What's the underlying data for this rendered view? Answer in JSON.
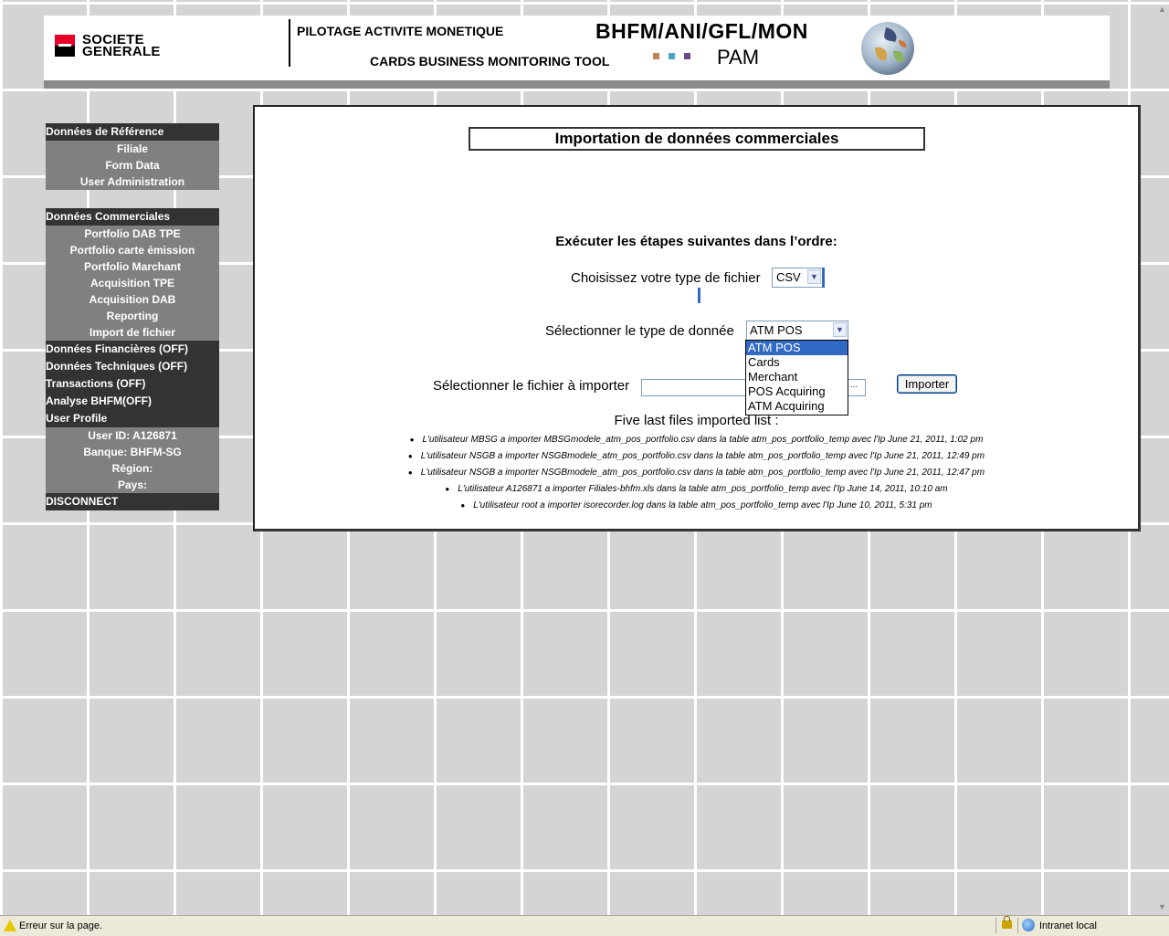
{
  "header": {
    "logo_line1": "SOCIETE",
    "logo_line2": "GENERALE",
    "title_fr": "PILOTAGE ACTIVITE MONETIQUE",
    "title_en": "CARDS BUSINESS MONITORING TOOL",
    "code": "BHFM/ANI/GFL/MON",
    "short": "PAM",
    "colors": {
      "brand_red": "#e60028",
      "bar_gray": "#8a8a8a"
    },
    "icons": [
      "globe-icon"
    ]
  },
  "sidebar": {
    "ref": {
      "header": "Données de Référence",
      "items": [
        "Filiale",
        "Form Data",
        "User Administration"
      ]
    },
    "commercial": {
      "header": "Données Commerciales",
      "items": [
        "Portfolio DAB TPE",
        "Portfolio carte émission",
        "Portfolio Marchant",
        "Acquisition TPE",
        "Acquisition DAB",
        "Reporting",
        "Import de fichier"
      ]
    },
    "other": {
      "financial": "Données Financières (OFF)",
      "technical": "Données Techniques (OFF)",
      "transactions": "Transactions (OFF)",
      "analysis": "Analyse BHFM(OFF)",
      "profile_header": "User Profile",
      "profile": {
        "user_id": "User ID: A126871",
        "bank": "Banque: BHFM-SG",
        "region": "Région:",
        "country": "Pays:"
      },
      "disconnect": "DISCONNECT"
    }
  },
  "main": {
    "title": "Importation de données commerciales",
    "instructions": "Exécuter les étapes suivantes dans l’ordre:",
    "file_type": {
      "label": "Choisissez votre type de fichier",
      "value": "CSV"
    },
    "data_type": {
      "label": "Sélectionner le type de donnée",
      "value": "ATM POS",
      "options": [
        "ATM POS",
        "Cards",
        "Merchant",
        "POS Acquiring",
        "ATM Acquiring"
      ],
      "selected_index": 0
    },
    "file_picker": {
      "label": "Sélectionner le fichier à importer",
      "value": "",
      "browse_stub": "..."
    },
    "import_button": "Importer",
    "files": {
      "title": "Five last files imported list :",
      "items": [
        "L'utilisateur MBSG a importer MBSGmodele_atm_pos_portfolio.csv dans la table atm_pos_portfolio_temp avec l'Ip June 21, 2011, 1:02 pm",
        "L'utilisateur NSGB a importer NSGBmodele_atm_pos_portfolio.csv dans la table atm_pos_portfolio_temp avec l'Ip June 21, 2011, 12:49 pm",
        "L'utilisateur NSGB a importer NSGBmodele_atm_pos_portfolio.csv dans la table atm_pos_portfolio_temp avec l'Ip June 21, 2011, 12:47 pm",
        "L'utilisateur A126871 a importer Filiales-bhfm.xls dans la table atm_pos_portfolio_temp avec l'Ip June 14, 2011, 10:10 am",
        "L'utilisateur root a importer isorecorder.log dans la table atm_pos_portfolio_temp avec l'Ip June 10, 2011, 5:31 pm"
      ]
    }
  },
  "status_bar": {
    "text": "Erreur sur la page.",
    "zone": "Intranet local",
    "icons": [
      "warning-icon",
      "lock-icon",
      "intranet-icon"
    ]
  }
}
